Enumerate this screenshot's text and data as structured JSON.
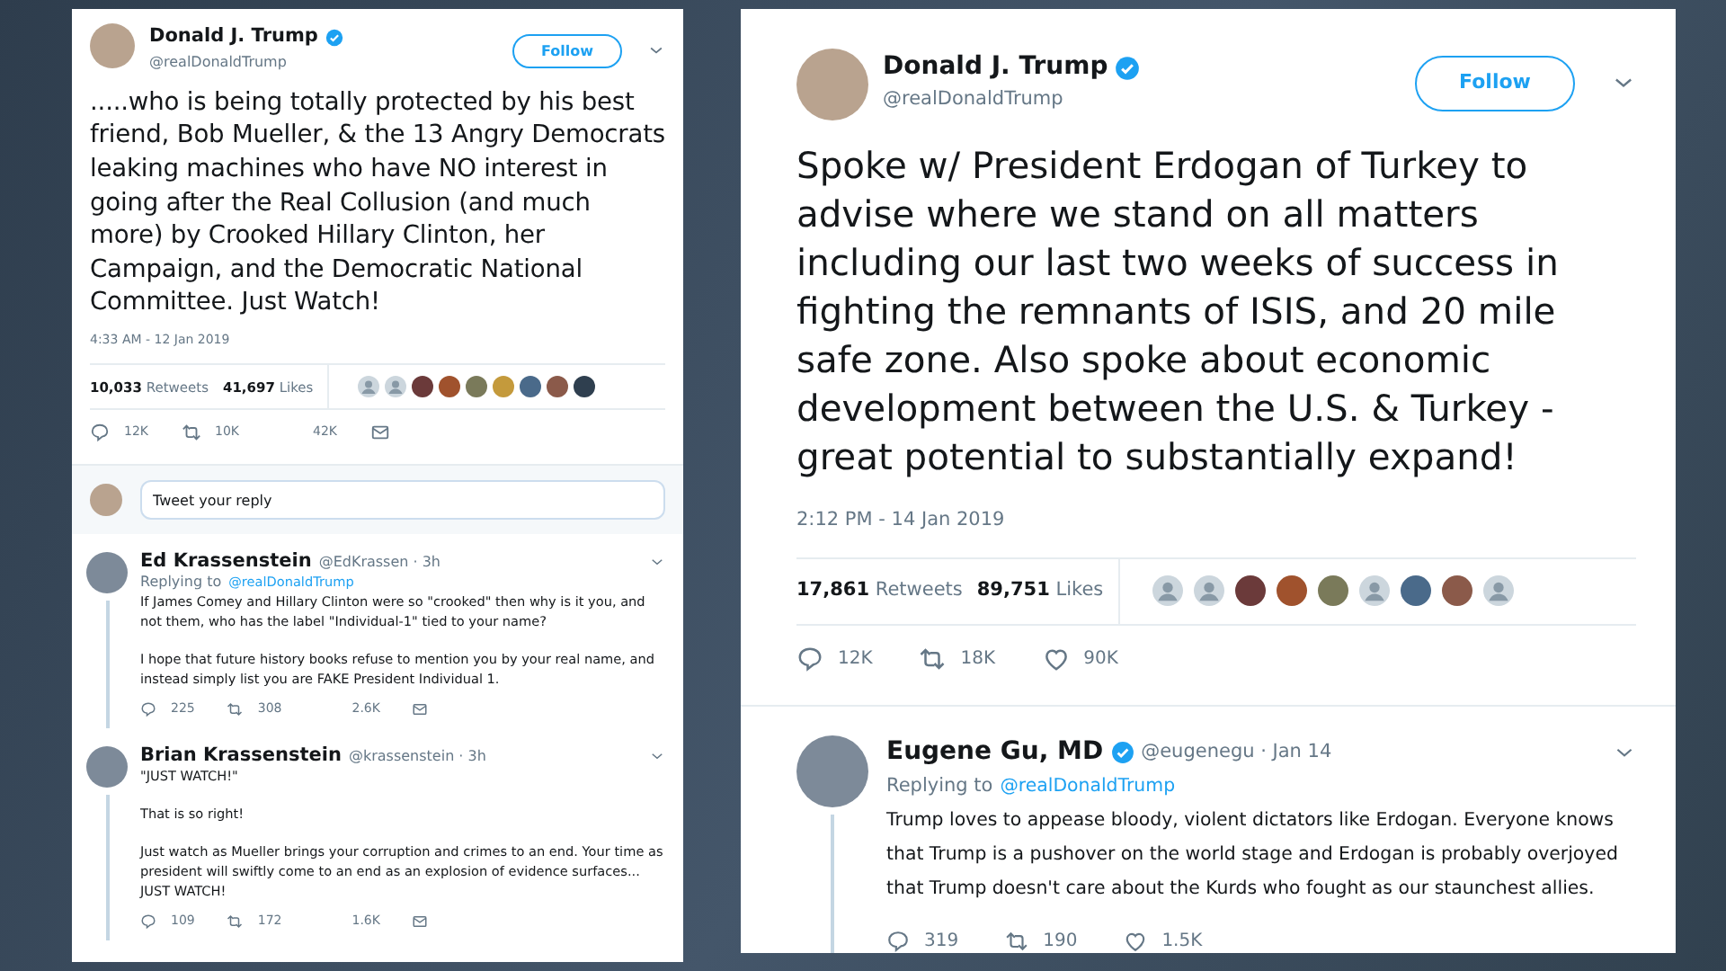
{
  "panels": [
    {
      "main_tweet": {
        "name": "Donald J. Trump",
        "verified": true,
        "handle": "@realDonaldTrump",
        "follow": "Follow",
        "text": ".....who is being totally protected by his best friend, Bob Mueller, & the 13 Angry Democrats   leaking machines who have NO interest in going after the Real Collusion (and much more) by Crooked Hillary Clinton, her Campaign, and the Democratic National Committee. Just Watch!",
        "timestamp": "4:33 AM - 12 Jan 2019",
        "retweets_count": "10,033",
        "retweets_label": "Retweets",
        "likes_count": "41,697",
        "likes_label": "Likes",
        "liker_avatars": [
          {
            "kind": "default"
          },
          {
            "kind": "default"
          },
          {
            "kind": "photo"
          },
          {
            "kind": "photo"
          },
          {
            "kind": "photo"
          },
          {
            "kind": "photo"
          },
          {
            "kind": "photo"
          },
          {
            "kind": "photo"
          },
          {
            "kind": "photo"
          }
        ],
        "actions": [
          {
            "kind": "reply",
            "count": "12K"
          },
          {
            "kind": "retweet",
            "count": "10K"
          },
          {
            "kind": "count",
            "count": "42K"
          },
          {
            "kind": "message"
          }
        ]
      },
      "reply_box": {
        "placeholder": "Tweet your reply"
      },
      "replies": [
        {
          "name": "Ed Krassenstein",
          "verified": false,
          "meta": "@EdKrassen · 3h",
          "replying_label": "Replying to",
          "replying_to": "@realDonaldTrump",
          "paragraphs": [
            "If James Comey and Hillary Clinton were so \"crooked\" then why is it you, and not them, who has the label \"Individual-1\" tied to your name?",
            "I hope that future history books refuse to mention you by your real name, and instead simply list you are FAKE President Individual 1."
          ],
          "thread_line": true,
          "actions": [
            {
              "kind": "reply",
              "count": "225"
            },
            {
              "kind": "retweet",
              "count": "308"
            },
            {
              "kind": "count",
              "count": "2.6K"
            },
            {
              "kind": "message"
            }
          ]
        },
        {
          "name": "Brian Krassenstein",
          "verified": false,
          "meta": "@krassenstein · 3h",
          "paragraphs": [
            "\"JUST WATCH!\"",
            "That is so right!",
            "Just watch as Mueller brings your corruption and crimes to an end.  Your time as president will swiftly come to an end as an explosion of evidence surfaces... JUST WATCH!"
          ],
          "thread_line": true,
          "actions": [
            {
              "kind": "reply",
              "count": "109"
            },
            {
              "kind": "retweet",
              "count": "172"
            },
            {
              "kind": "count",
              "count": "1.6K"
            },
            {
              "kind": "message"
            }
          ]
        }
      ]
    },
    {
      "main_tweet": {
        "name": "Donald J. Trump",
        "verified": true,
        "handle": "@realDonaldTrump",
        "follow": "Follow",
        "text": "Spoke w/ President Erdogan of Turkey to advise where we stand on all matters including our last two weeks of success in fighting the remnants of ISIS, and 20 mile safe zone. Also spoke about economic development between the U.S. & Turkey - great potential to substantially expand!",
        "timestamp": "2:12 PM - 14 Jan 2019",
        "retweets_count": "17,861",
        "retweets_label": "Retweets",
        "likes_count": "89,751",
        "likes_label": "Likes",
        "liker_avatars": [
          {
            "kind": "default"
          },
          {
            "kind": "default"
          },
          {
            "kind": "photo"
          },
          {
            "kind": "photo"
          },
          {
            "kind": "photo"
          },
          {
            "kind": "default"
          },
          {
            "kind": "photo"
          },
          {
            "kind": "photo"
          },
          {
            "kind": "default"
          }
        ],
        "actions": [
          {
            "kind": "reply",
            "count": "12K"
          },
          {
            "kind": "retweet",
            "count": "18K"
          },
          {
            "kind": "like",
            "count": "90K"
          }
        ]
      },
      "replies": [
        {
          "name": "Eugene Gu, MD",
          "verified": true,
          "meta": "@eugenegu · Jan 14",
          "replying_label": "Replying to",
          "replying_to": "@realDonaldTrump",
          "paragraphs": [
            "Trump loves to appease bloody, violent dictators like Erdogan. Everyone knows that Trump is a pushover on the world stage and Erdogan is probably overjoyed that Trump doesn't care about the Kurds who fought as our staunchest allies."
          ],
          "thread_line": true,
          "actions": [
            {
              "kind": "reply",
              "count": "319"
            },
            {
              "kind": "retweet",
              "count": "190"
            },
            {
              "kind": "like",
              "count": "1.5K"
            }
          ]
        }
      ]
    }
  ]
}
